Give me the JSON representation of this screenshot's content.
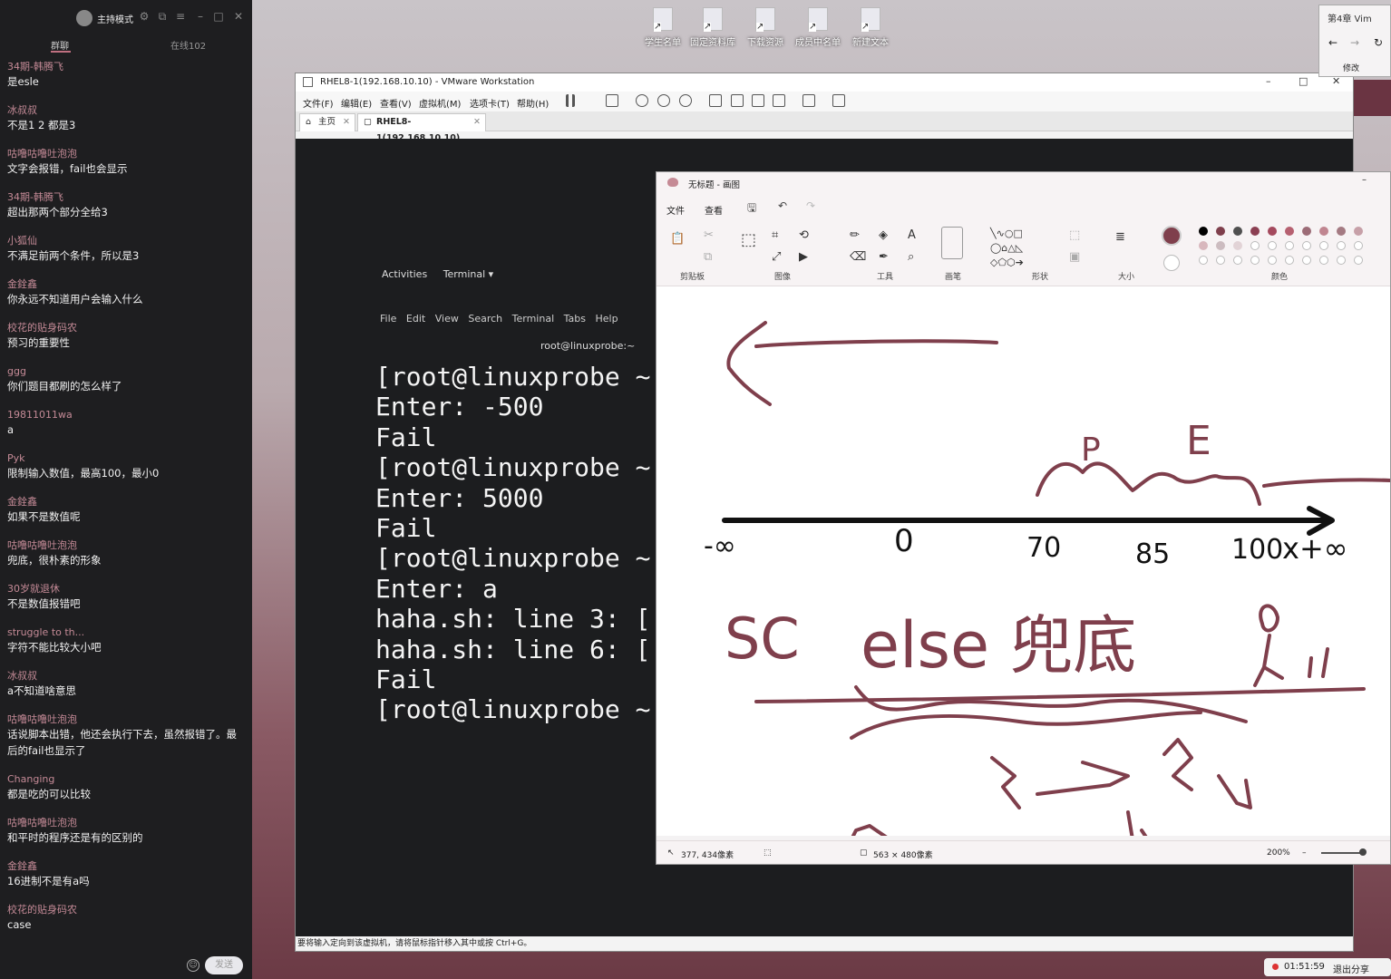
{
  "chat": {
    "mode_label": "主持模式",
    "tabs": {
      "group": "群聊",
      "online": "在线102"
    },
    "messages": [
      {
        "name": "34期-韩腾飞",
        "text": "是esle"
      },
      {
        "name": "冰叔叔",
        "text": "不是1 2 都是3"
      },
      {
        "name": "咕噜咕噜吐泡泡",
        "text": "文字会报错，fail也会显示"
      },
      {
        "name": "34期-韩腾飞",
        "text": "超出那两个部分全给3"
      },
      {
        "name": "小狐仙",
        "text": "不满足前两个条件，所以是3"
      },
      {
        "name": "金銓鑫",
        "text": "你永远不知道用户会输入什么"
      },
      {
        "name": "校花的贴身码农",
        "text": "预习的重要性"
      },
      {
        "name": "ggg",
        "text": "你们题目都刷的怎么样了"
      },
      {
        "name": "19811011wa",
        "text": "a"
      },
      {
        "name": "Pyk",
        "text": "限制输入数值，最高100，最小0"
      },
      {
        "name": "金銓鑫",
        "text": "如果不是数值呢"
      },
      {
        "name": "咕噜咕噜吐泡泡",
        "text": "兜底，很朴素的形象"
      },
      {
        "name": "30岁就退休",
        "text": "不是数值报错吧"
      },
      {
        "name": "struggle to th...",
        "text": "字符不能比较大小吧"
      },
      {
        "name": "冰叔叔",
        "text": "a不知道啥意思"
      },
      {
        "name": "咕噜咕噜吐泡泡",
        "text": "话说脚本出错，他还会执行下去，虽然报错了。最后的fail也显示了"
      },
      {
        "name": "Changing",
        "text": "都是吃的可以比较"
      },
      {
        "name": "咕噜咕噜吐泡泡",
        "text": "和平时的程序还是有的区别的"
      },
      {
        "name": "金銓鑫",
        "text": "16进制不是有a吗"
      },
      {
        "name": "校花的贴身码农",
        "text": "case"
      }
    ],
    "send_label": "发送"
  },
  "desktop_icons": [
    "学生名单",
    "固定资料库",
    "下载资源",
    "成员中名单",
    "新建文本"
  ],
  "vmware": {
    "title": "RHEL8-1(192.168.10.10) - VMware Workstation",
    "menu": [
      "文件(F)",
      "编辑(E)",
      "查看(V)",
      "虚拟机(M)",
      "选项卡(T)",
      "帮助(H)"
    ],
    "tabs": {
      "home": "主页",
      "vm": "RHEL8-1(192.168.10.10)"
    },
    "gnome": {
      "activities": "Activities",
      "terminal": "Terminal ▾"
    },
    "term_menu": [
      "File",
      "Edit",
      "View",
      "Search",
      "Terminal",
      "Tabs",
      "Help"
    ],
    "term_title": "root@linuxprobe:~",
    "terminal_lines": "[root@linuxprobe ~\nEnter: -500\nFail\n[root@linuxprobe ~\nEnter: 5000\nFail\n[root@linuxprobe ~\nEnter: a\nhaha.sh: line 3: [\nhaha.sh: line 6: [\nFail\n[root@linuxprobe ~",
    "status": "要将输入定向到该虚拟机，请将鼠标指针移入其中或按 Ctrl+G。"
  },
  "paint": {
    "title": "无标题 - 画图",
    "menu": {
      "file": "文件",
      "view": "查看"
    },
    "groups": [
      "剪贴板",
      "图像",
      "工具",
      "画笔",
      "形状",
      "大小",
      "颜色"
    ],
    "status": {
      "pos": "377, 434像素",
      "size": "563 × 480像素",
      "zoom": "200%"
    },
    "drawing_labels": {
      "neg_inf": "-∞",
      "zero": "0",
      "seventy": "70",
      "eighty_five": "85",
      "hundred": "100",
      "x_plus_inf": "x+∞",
      "P": "P",
      "E": "E",
      "else": "else 兜底",
      "sc": "SC"
    },
    "colors": [
      "#000000",
      "#7f3f4c",
      "#505050",
      "#8b3f52",
      "#a4495d",
      "#b66070",
      "#9c6b76",
      "#c08590",
      "#a47a82",
      "#c7a0a8",
      "#d8b7bd",
      "#ccbcc0",
      "#e2d3d6"
    ]
  },
  "browser": {
    "tab": "第4章 Vim",
    "edit": "修改"
  },
  "share": {
    "time": "01:51:59",
    "exit": "退出分享"
  }
}
